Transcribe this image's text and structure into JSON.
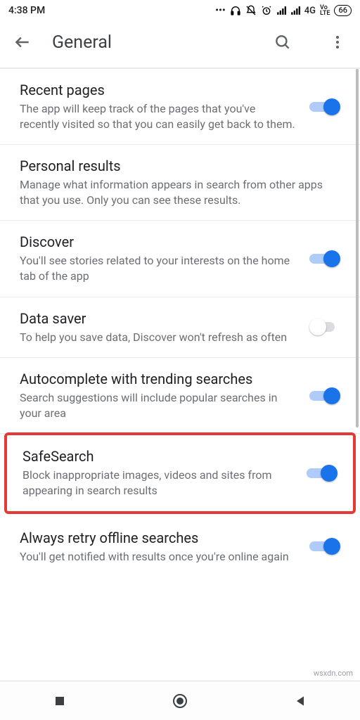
{
  "statusbar": {
    "time": "4:38 PM",
    "network_label": "4G",
    "volte": "Vo\nLTE",
    "battery": "66"
  },
  "appbar": {
    "title": "General"
  },
  "settings": [
    {
      "title": "Recent pages",
      "desc": "The app will keep track of the pages that you've recently visited so that you can easily get back to them.",
      "on": true
    },
    {
      "title": "Personal results",
      "desc": "Manage what information appears in search from other apps that you use. Only you can see these results.",
      "on": null
    },
    {
      "title": "Discover",
      "desc": "You'll see stories related to your interests on the home tab of the app",
      "on": true
    },
    {
      "title": "Data saver",
      "desc": "To help you save data, Discover won't refresh as often",
      "on": false
    },
    {
      "title": "Autocomplete with trending searches",
      "desc": "Search suggestions will include popular searches in your area",
      "on": true
    },
    {
      "title": "SafeSearch",
      "desc": "Block inappropriate images, videos and sites from appearing in search results",
      "on": true,
      "highlighted": true
    },
    {
      "title": "Always retry offline searches",
      "desc": "You'll get notified with results once you're online again",
      "on": true
    }
  ],
  "watermark": "wsxdn.com"
}
